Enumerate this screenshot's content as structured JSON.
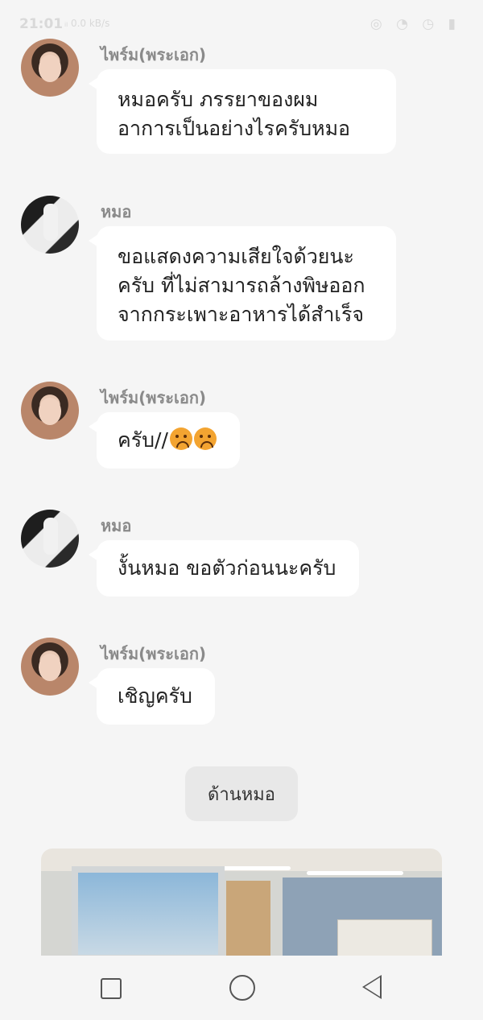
{
  "status_bar": {
    "time": "21:01",
    "signal": "ᵢₗ 0.0 kB/s",
    "right_icons": "◎ ◔ ◷ ▮"
  },
  "messages": [
    {
      "sender": "ไพร์ม(พระเอก)",
      "avatar": "hero-avatar",
      "text": "หมอครับ ภรรยาของผม\nอาการเป็นอย่างไรครับหมอ"
    },
    {
      "sender": "หมอ",
      "avatar": "doctor-avatar",
      "text": "ขอแสดงความเสียใจด้วยนะ\nครับ ที่ไม่สามารถล้างพิษออก\nจากกระเพาะอาหารได้สำเร็จ"
    },
    {
      "sender": "ไพร์ม(พระเอก)",
      "avatar": "hero-avatar",
      "text": "ครับ//",
      "emojis": [
        "worried-face",
        "worried-face"
      ]
    },
    {
      "sender": "หมอ",
      "avatar": "doctor-avatar",
      "text": "งั้นหมอ ขอตัวก่อนนะครับ"
    },
    {
      "sender": "ไพร์ม(พระเอก)",
      "avatar": "hero-avatar",
      "text": "เชิญครับ"
    }
  ],
  "scene_button": {
    "label": "ด้านหมอ"
  },
  "scene_image": {
    "description_icon": "hospital-room-image"
  },
  "nav": {
    "recents": "square-icon",
    "home": "circle-icon",
    "back": "triangle-back-icon"
  }
}
